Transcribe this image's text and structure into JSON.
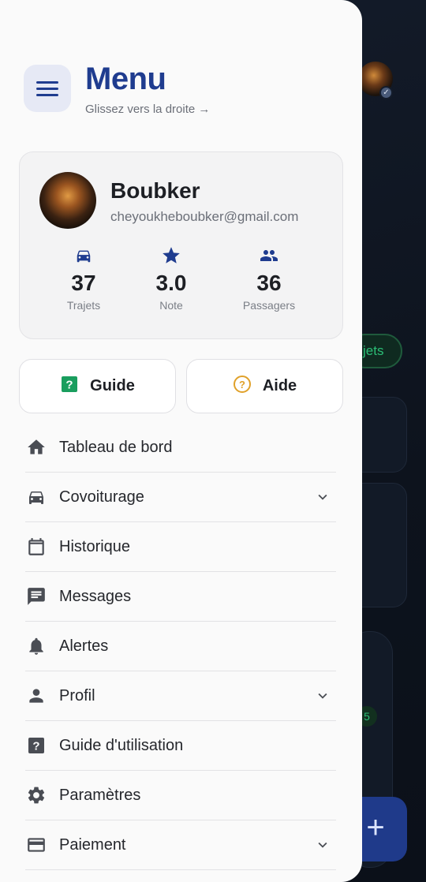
{
  "header": {
    "title": "Menu",
    "subtitle": "Glissez vers la droite →"
  },
  "profile": {
    "name": "Boubker",
    "email": "cheyoukheboubker@gmail.com",
    "stats": [
      {
        "icon": "car-icon",
        "value": "37",
        "label": "Trajets"
      },
      {
        "icon": "star-icon",
        "value": "3.0",
        "label": "Note"
      },
      {
        "icon": "people-icon",
        "value": "36",
        "label": "Passagers"
      }
    ]
  },
  "quick_actions": {
    "guide_label": "Guide",
    "help_label": "Aide"
  },
  "menu": {
    "items": [
      {
        "icon": "home-icon",
        "label": "Tableau de bord",
        "expandable": false
      },
      {
        "icon": "car-icon",
        "label": "Covoiturage",
        "expandable": true
      },
      {
        "icon": "calendar-icon",
        "label": "Historique",
        "expandable": false
      },
      {
        "icon": "message-icon",
        "label": "Messages",
        "expandable": false
      },
      {
        "icon": "bell-icon",
        "label": "Alertes",
        "expandable": false
      },
      {
        "icon": "person-icon",
        "label": "Profil",
        "expandable": true
      },
      {
        "icon": "help-box-icon",
        "label": "Guide d'utilisation",
        "expandable": false
      },
      {
        "icon": "settings-icon",
        "label": "Paramètres",
        "expandable": false
      },
      {
        "icon": "credit-card-icon",
        "label": "Paiement",
        "expandable": true
      }
    ]
  },
  "background": {
    "chip_label": "jets",
    "badge_value": "5"
  },
  "colors": {
    "accent": "#1f3c8f",
    "guide_green": "#1a9e5e",
    "help_orange": "#e0a12a",
    "drawer_bg": "#fafafa"
  }
}
